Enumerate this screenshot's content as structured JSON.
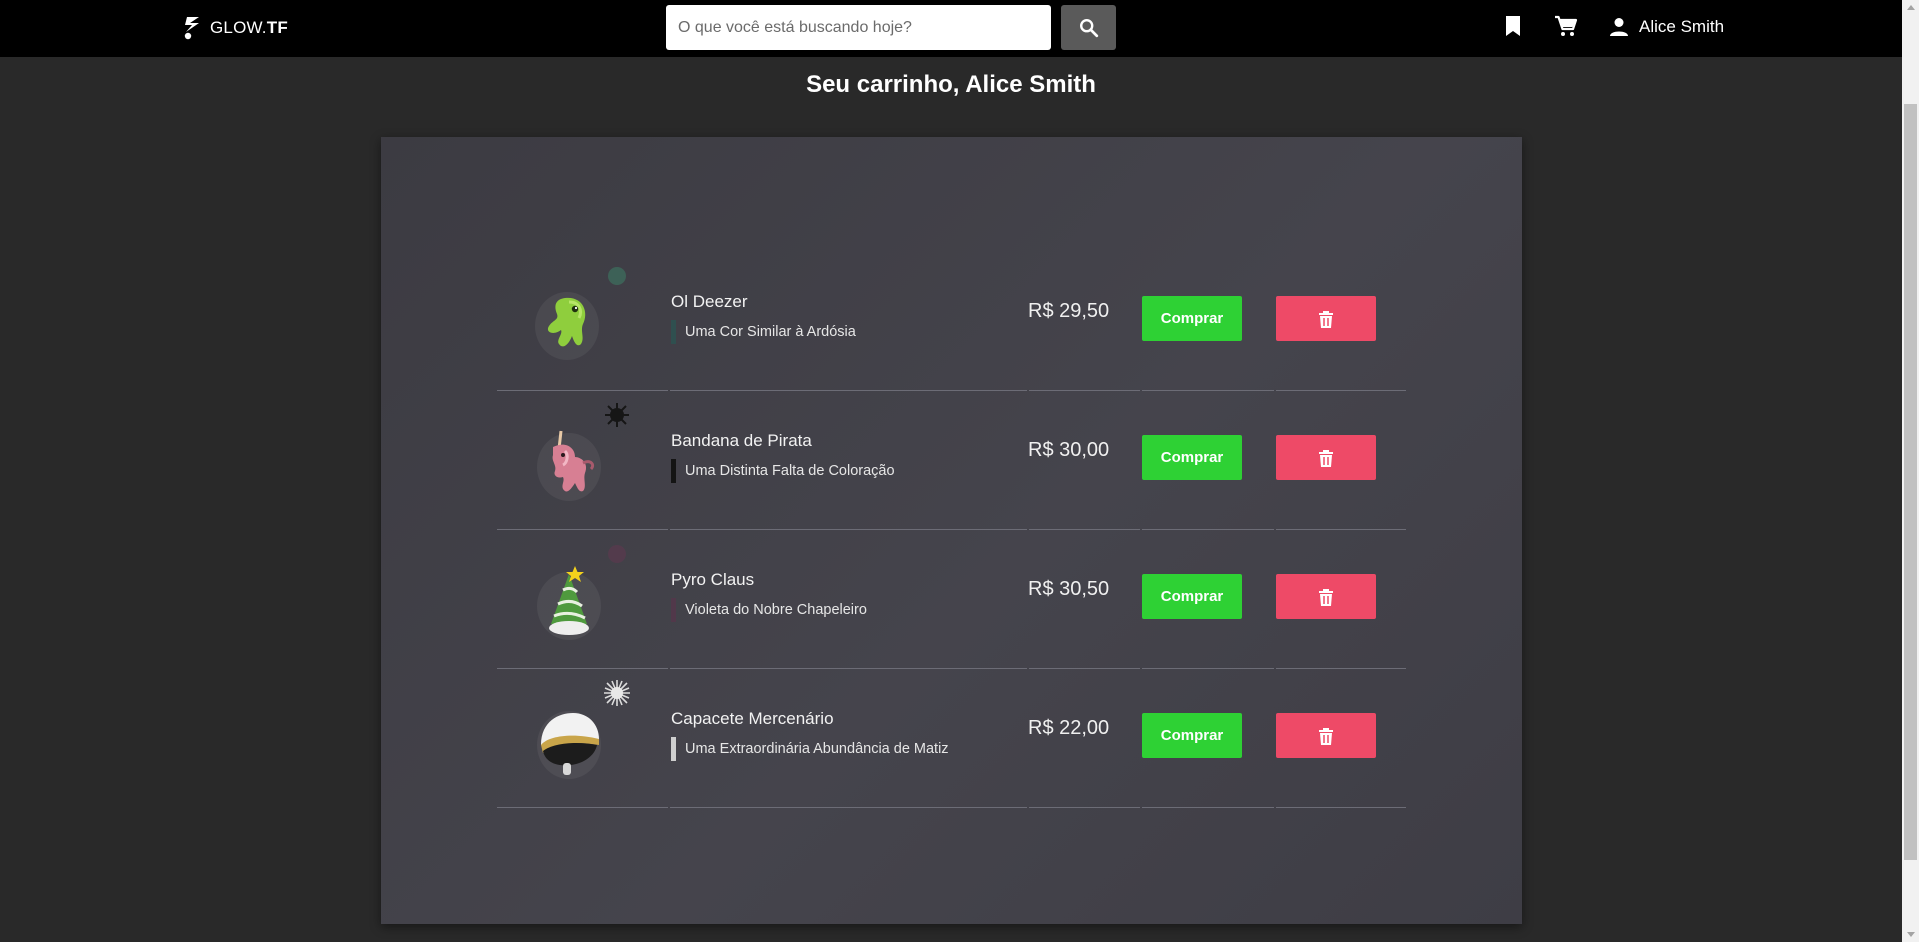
{
  "header": {
    "logo": {
      "prefix": "GLOW.",
      "suffix": "TF"
    },
    "search": {
      "placeholder": "O que você está buscando hoje?",
      "value": ""
    },
    "icons": [
      "bookmark-icon",
      "cart-icon",
      "user-icon"
    ],
    "user_name": "Alice Smith"
  },
  "page_title": "Seu carrinho, Alice Smith",
  "cart": {
    "buy_label": "Comprar",
    "items": [
      {
        "name": "Ol Deezer",
        "paint": "Uma Cor Similar à Ardósia",
        "paint_color": "#2f4f4f",
        "price": "R$ 29,50",
        "art": "green-blob",
        "effect_color": "#3d6e5e"
      },
      {
        "name": "Bandana de Pirata",
        "paint": "Uma Distinta Falta de Coloração",
        "paint_color": "#141414",
        "price": "R$ 30,00",
        "art": "pink-unicorn",
        "effect_color": "#161616"
      },
      {
        "name": "Pyro Claus",
        "paint": "Violeta do Nobre Chapeleiro",
        "paint_color": "#51384a",
        "price": "R$ 30,50",
        "art": "christmas-hat",
        "effect_color": "#5a3a4e"
      },
      {
        "name": "Capacete Mercenário",
        "paint": "Uma Extraordinária Abundância de Matiz",
        "paint_color": "#cfcfcf",
        "price": "R$ 22,00",
        "art": "helmet",
        "effect_color": "#d8d8d8"
      }
    ]
  },
  "colors": {
    "buy": "#2ed134",
    "delete": "#ee4a67",
    "topbar": "#000000",
    "background": "#292929"
  }
}
